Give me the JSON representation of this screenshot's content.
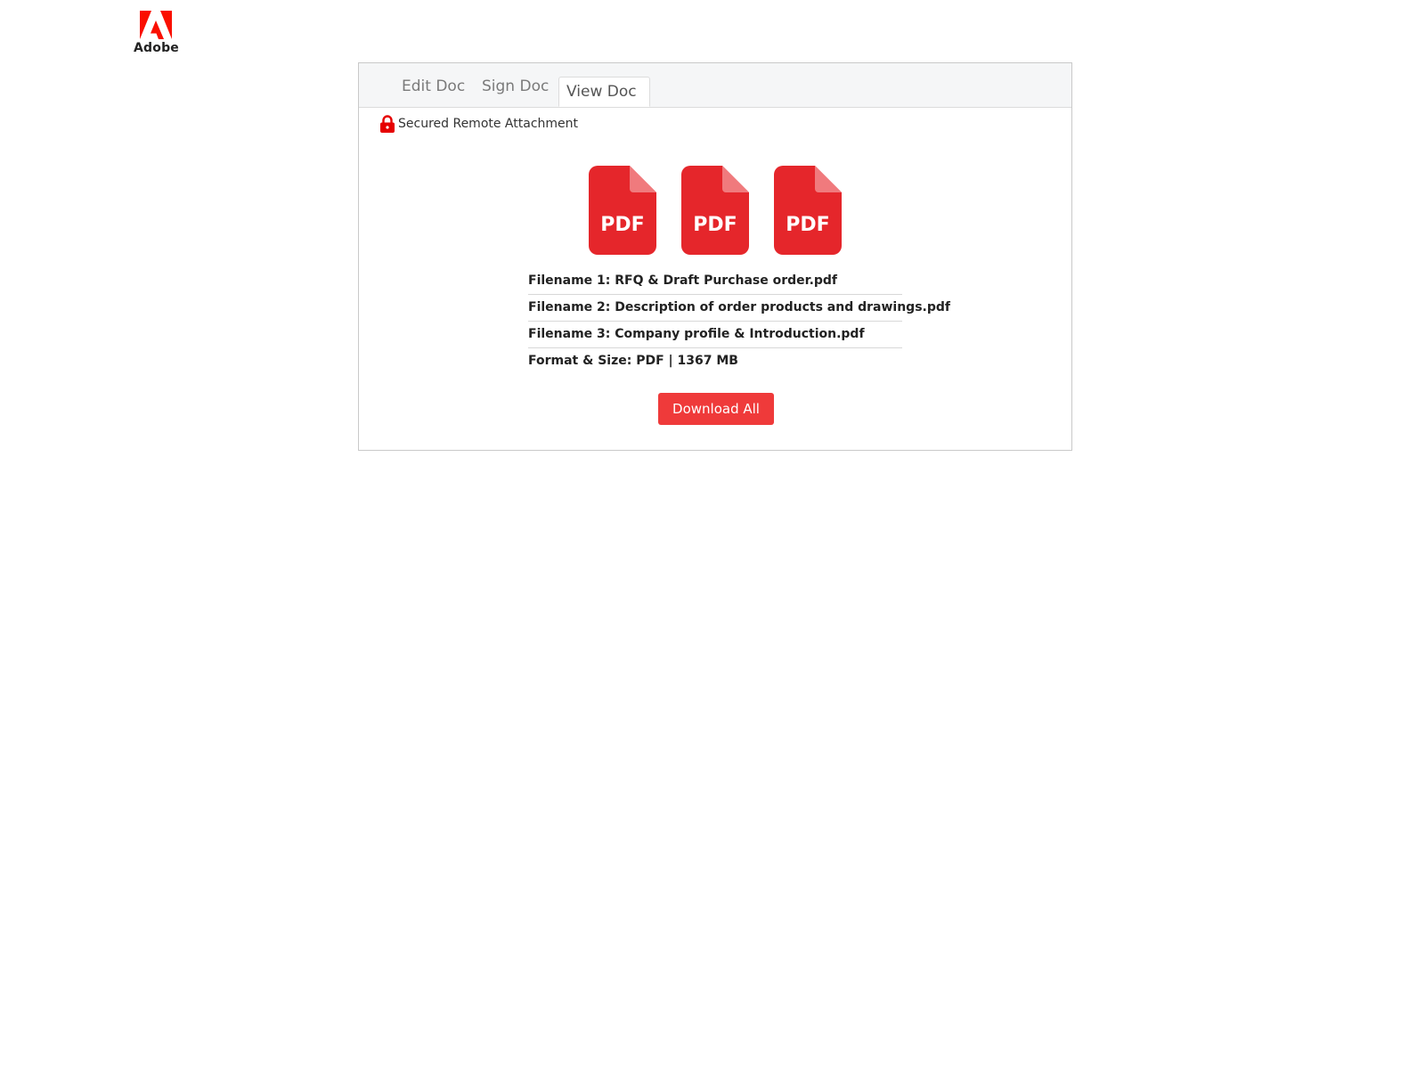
{
  "brand": {
    "name": "Adobe",
    "logo_icon": "adobe-logo-icon",
    "color": "#fa0f00"
  },
  "tabs": [
    {
      "label": "Edit Doc",
      "active": false
    },
    {
      "label": "Sign Doc",
      "active": false
    },
    {
      "label": "View Doc",
      "active": true
    }
  ],
  "secured": {
    "icon": "lock-icon",
    "label": "Secured Remote Attachment",
    "icon_color": "#e60000"
  },
  "pdf_icons": [
    {
      "label": "PDF",
      "icon": "pdf-file-icon"
    },
    {
      "label": "PDF",
      "icon": "pdf-file-icon"
    },
    {
      "label": "PDF",
      "icon": "pdf-file-icon"
    }
  ],
  "pdf_icon_color": "#e5262b",
  "files": [
    "Filename 1: RFQ & Draft Purchase order.pdf",
    "Filename 2: Description of order products and drawings.pdf",
    "Filename 3: Company profile & Introduction.pdf"
  ],
  "format_size": "Format & Size: PDF | 1367 MB",
  "download_button": {
    "label": "Download All",
    "color": "#ef3a3a"
  }
}
